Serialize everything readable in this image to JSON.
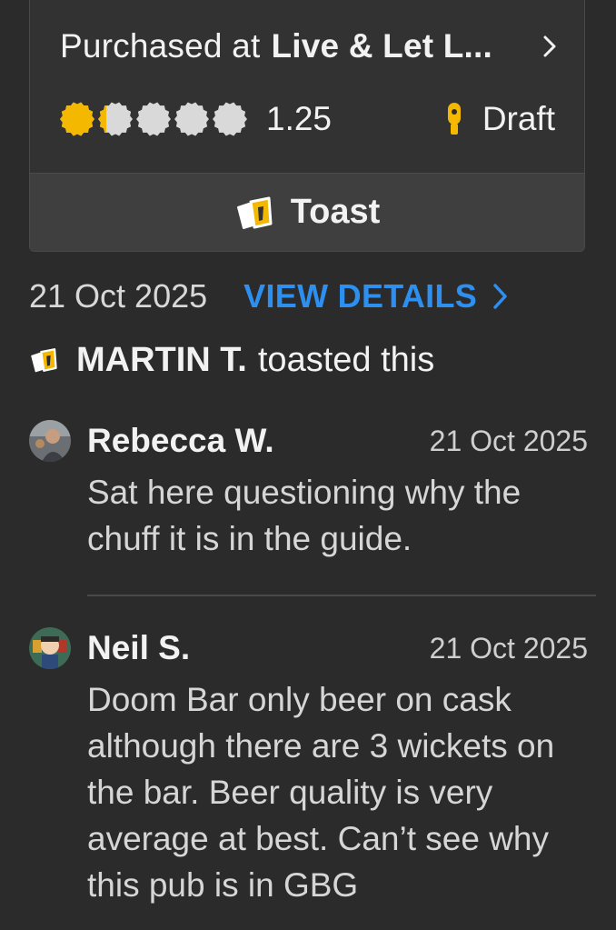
{
  "checkin": {
    "purchased_prefix": "Purchased at",
    "venue": "Live & Let L...",
    "rating": "1.25",
    "rating_fraction": 0.25,
    "caps_total": 5,
    "serving_style": "Draft",
    "toast_label": "Toast"
  },
  "meta": {
    "date": "21 Oct 2025",
    "view_details": "VIEW DETAILS"
  },
  "toasts": {
    "name": "MARTIN T.",
    "suffix": "toasted this"
  },
  "comments": [
    {
      "name": "Rebecca W.",
      "date": "21 Oct 2025",
      "text": "Sat here questioning why the chuff it is in the guide."
    },
    {
      "name": "Neil S.",
      "date": "21 Oct 2025",
      "text": "Doom Bar only beer on cask although there are 3 wickets on the bar. Beer quality is very average at best. Can’t see why this pub is in GBG"
    }
  ],
  "colors": {
    "background": "#2b2b2b",
    "accent_link": "#2d8ff0",
    "cap_filled": "#f5b800",
    "cap_empty": "#d9d9d9"
  }
}
